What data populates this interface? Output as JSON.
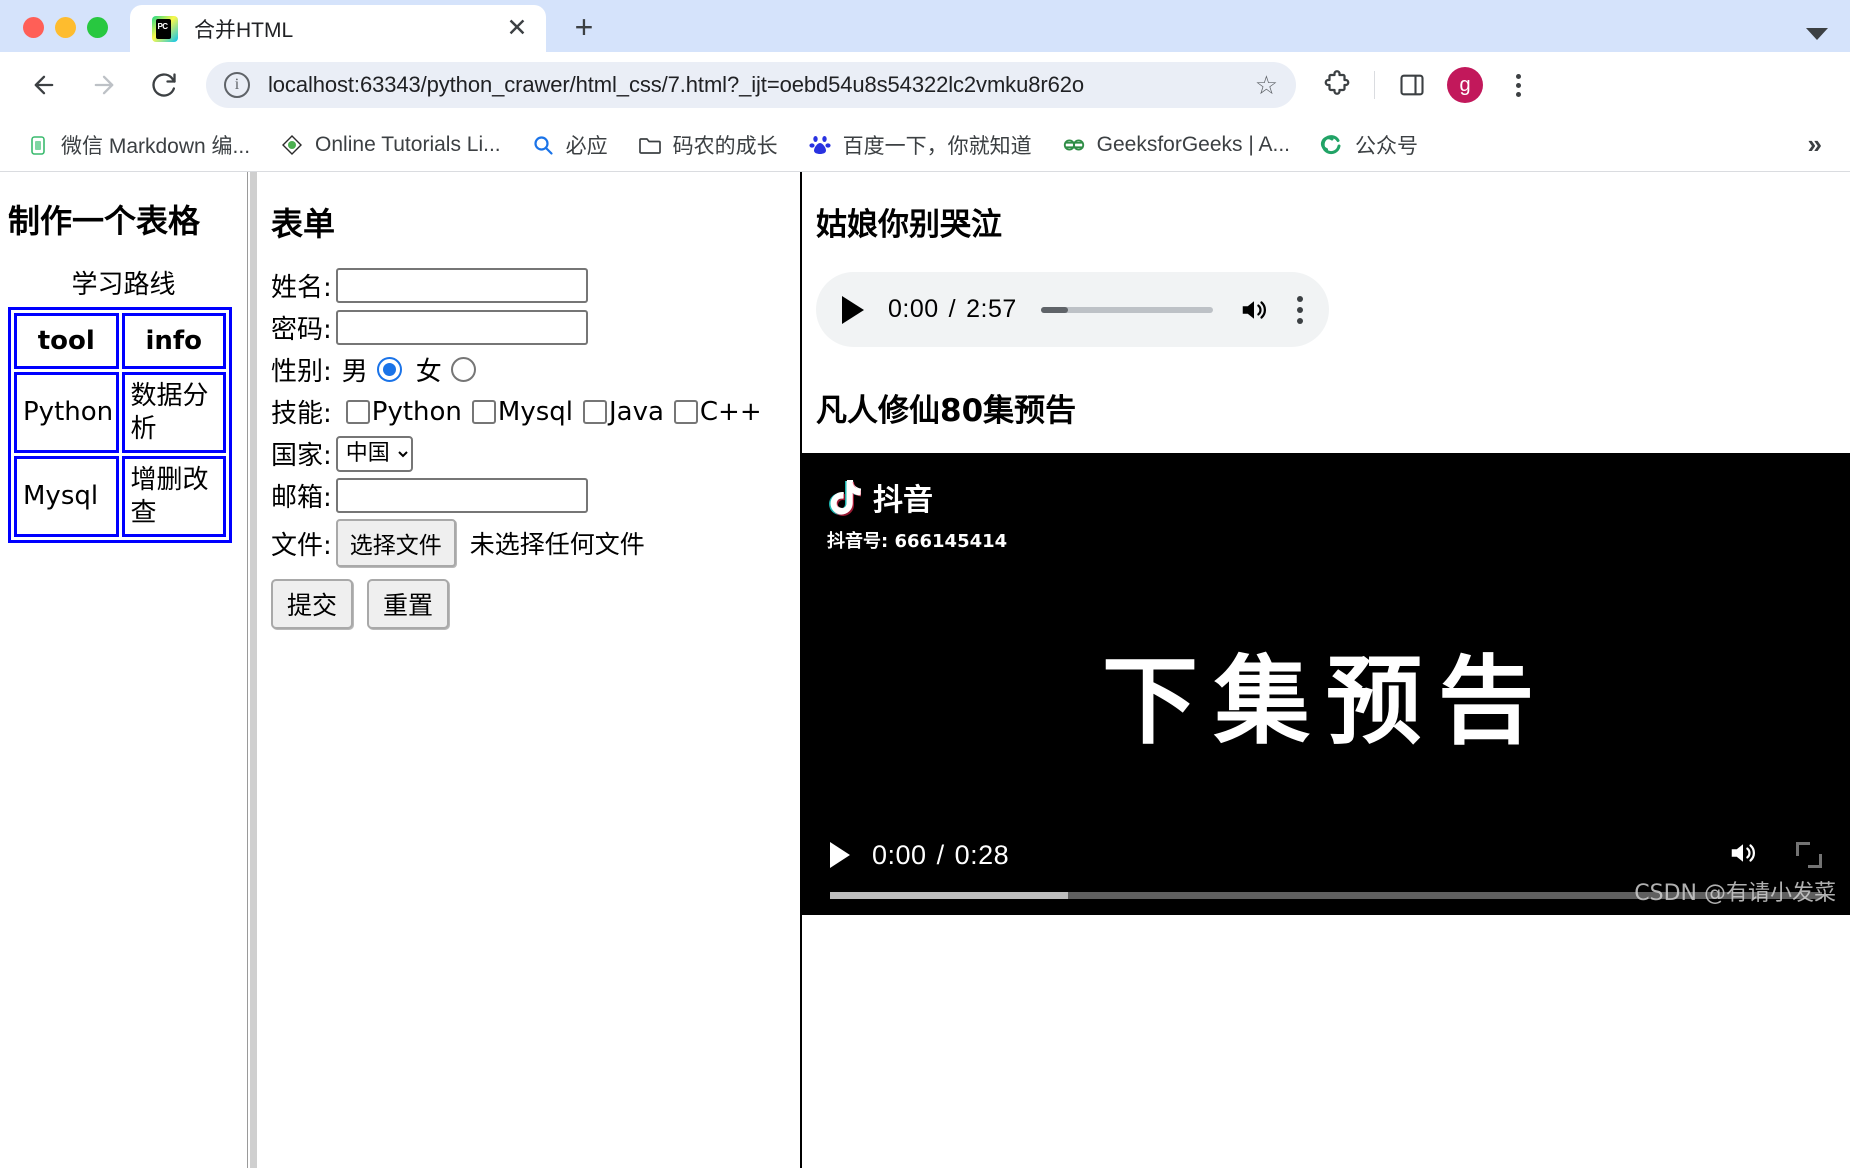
{
  "browser": {
    "tab": {
      "title": "合并HTML",
      "favicon_label": "PC",
      "close_label": "✕"
    },
    "new_tab_label": "+",
    "tabstrip_chevron": "chevron-down",
    "nav": {
      "back": "←",
      "forward": "→",
      "reload": "⟳"
    },
    "omnibox": {
      "info_glyph": "i",
      "url": "localhost:63343/python_crawer/html_css/7.html?_ijt=oebd54u8s54322lc2vmku8r62o",
      "star_glyph": "☆"
    },
    "toolbar_right": {
      "extensions_label": "extensions-puzzle",
      "sidepanel_label": "side-panel",
      "avatar_letter": "g",
      "menu_label": "kebab-menu"
    },
    "bookmarks": [
      {
        "label": "微信 Markdown 编...",
        "icon": "wechat-markdown-icon"
      },
      {
        "label": "Online Tutorials Li...",
        "icon": "tutorials-icon"
      },
      {
        "label": "必应",
        "icon": "bing-search-icon"
      },
      {
        "label": "码农的成长",
        "icon": "folder-icon"
      },
      {
        "label": "百度一下，你就知道",
        "icon": "baidu-paw-icon"
      },
      {
        "label": "GeeksforGeeks | A...",
        "icon": "geeksforgeeks-icon"
      },
      {
        "label": "公众号",
        "icon": "green-swirl-icon"
      }
    ],
    "bookmarks_overflow": "»"
  },
  "left_panel": {
    "heading": "制作一个表格",
    "table": {
      "caption": "学习路线",
      "headers": [
        "tool",
        "info"
      ],
      "rows": [
        [
          "Python",
          "数据分析"
        ],
        [
          "Mysql",
          "增删改查"
        ]
      ]
    }
  },
  "form_panel": {
    "heading": "表单",
    "fields": {
      "name_label": "姓名:",
      "name_value": "",
      "password_label": "密码:",
      "password_value": "",
      "gender_label": "性别:",
      "gender_options": [
        "男",
        "女"
      ],
      "gender_selected": "男",
      "skills_label": "技能:",
      "skills": [
        "Python",
        "Mysql",
        "Java",
        "C++"
      ],
      "country_label": "国家:",
      "country_selected": "中国",
      "country_options": [
        "中国"
      ],
      "email_label": "邮箱:",
      "email_value": "",
      "file_label": "文件:",
      "file_button": "选择文件",
      "file_status": "未选择任何文件"
    },
    "buttons": {
      "submit": "提交",
      "reset": "重置"
    }
  },
  "media_panel": {
    "audio": {
      "heading": "姑娘你别哭泣",
      "current_time": "0:00",
      "separator": "/",
      "duration": "2:57",
      "play_label": "play",
      "volume_label": "volume-high",
      "menu_label": "more-options"
    },
    "video": {
      "heading": "凡人修仙80集预告",
      "watermark_name": "抖音",
      "watermark_id": "抖音号: 666145414",
      "caption_text": "下集预告",
      "current_time": "0:00",
      "separator": "/",
      "duration": "0:28",
      "play_label": "play",
      "volume_label": "volume-high",
      "fullscreen_label": "fullscreen"
    },
    "page_watermark": "CSDN @有请小发菜"
  },
  "colors": {
    "tabstrip": "#d5e3fb",
    "omnibox": "#eaeef6",
    "table_border": "#0000ff",
    "radio_accent": "#1a73e8",
    "avatar": "#c2185b"
  }
}
